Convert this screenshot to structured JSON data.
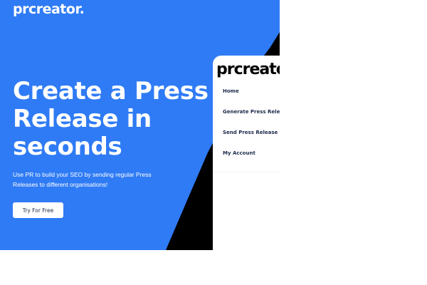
{
  "colors": {
    "hero_blue": "#2f7bf5",
    "black_accent": "#000000",
    "white": "#ffffff",
    "nav_text": "#1b2a4a"
  },
  "brand": {
    "logo_text": "prcreator."
  },
  "hero": {
    "headline_lines": [
      "Create a Press",
      "Release in",
      "seconds"
    ],
    "subtext": "Use PR to build your SEO by sending regular Press Releases to different organisations!",
    "cta_label": "Try For Free"
  },
  "mobile_menu": {
    "logo_text": "prcreator",
    "items": [
      {
        "label": "Home"
      },
      {
        "label": "Generate Press Release"
      },
      {
        "label": "Send Press Release"
      },
      {
        "label": "My Account"
      }
    ]
  }
}
